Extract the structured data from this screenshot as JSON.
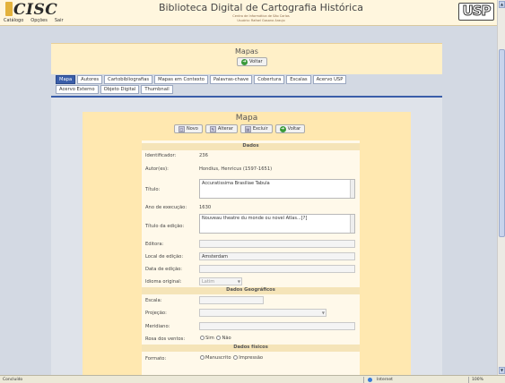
{
  "header": {
    "logo_text": "CISC",
    "menu": [
      "Catálogo",
      "Opções",
      "Sair"
    ],
    "title": "Biblioteca Digital de Cartografia Histórica",
    "subtitle": "Centro de Informática de São Carlos",
    "user": "Usuário: Rafael Gasano Araujo",
    "right_logo_text": "USP"
  },
  "mapas": {
    "title": "Mapas",
    "voltar": "Voltar"
  },
  "tabs": {
    "row1": [
      "Mapa",
      "Autores",
      "Cartobibliografias",
      "Mapas em Contexto",
      "Palavras-chave",
      "Cobertura",
      "Escalas",
      "Acervo USP"
    ],
    "row2": [
      "Acervo Externo",
      "Objeto Digital",
      "Thumbnail"
    ],
    "active": "Mapa"
  },
  "mapa": {
    "title": "Mapa",
    "toolbar": {
      "novo": "Novo",
      "alterar": "Alterar",
      "excluir": "Excluir",
      "voltar": "Voltar"
    }
  },
  "form": {
    "dados": "Dados",
    "identificador_label": "Identificador:",
    "identificador": "236",
    "autores_label": "Autor(es):",
    "autores": "Hondius, Henricus (1597-1651)",
    "titulo_label": "Título:",
    "titulo": "Accuratissima Brasiliae Tabula",
    "ano_label": "Ano de execução:",
    "ano": "1630",
    "titulo_edicao_label": "Título da edição:",
    "titulo_edicao": "Nouveau theatre du monde ou novel Atlas...[?]",
    "editora_label": "Editora:",
    "editora": "",
    "local_label": "Local de edição:",
    "local": "Amsterdam",
    "data_label": "Data de edição:",
    "data": "",
    "idioma_label": "Idioma original:",
    "idioma": "Latim",
    "dados_geo": "Dados Geográficos",
    "escala_label": "Escala:",
    "projecao_label": "Projeção:",
    "meridiano_label": "Meridiano:",
    "rosa_label": "Rosa dos ventos:",
    "sim": "Sim",
    "nao": "Não",
    "dados_fisicos": "Dados físicos",
    "formato_label": "Formato:",
    "manuscrito": "Manuscrito",
    "impressao": "Impressão"
  },
  "status": {
    "text": "Concluído",
    "zone": "Internet",
    "zoom": "100%"
  }
}
